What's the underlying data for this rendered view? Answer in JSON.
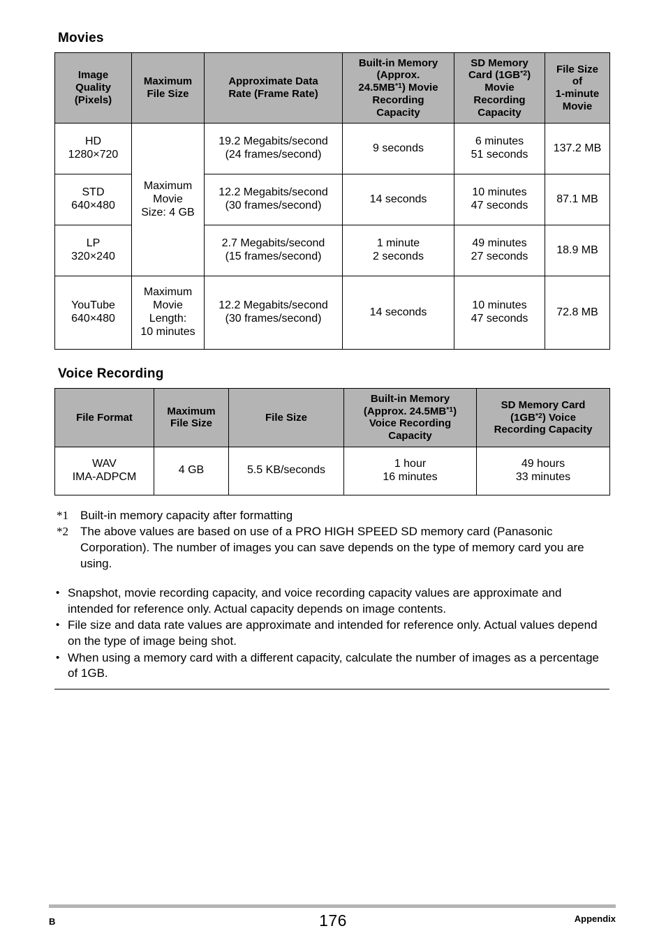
{
  "movies": {
    "heading": "Movies",
    "columns": [
      "Image Quality (Pixels)",
      "Maximum File Size",
      "Approximate Data Rate (Frame Rate)",
      "Built-in Memory (Approx. 24.5MB*1) Movie Recording Capacity",
      "SD Memory Card (1GB*2) Movie Recording Capacity",
      "File Size of 1-minute Movie"
    ],
    "header_lines": {
      "image_quality": [
        "Image",
        "Quality",
        "(Pixels)"
      ],
      "maximum_file_size": [
        "Maximum",
        "File Size"
      ],
      "approx_data_rate": [
        "Approximate Data",
        "Rate (Frame Rate)"
      ],
      "builtin_memory": [
        "Built-in Memory",
        "(Approx.",
        "24.5MB",
        "1",
        ") Movie",
        "Recording",
        "Capacity"
      ],
      "sd_memory": [
        "SD Memory",
        "Card (1GB",
        "2",
        ")",
        "Movie",
        "Recording",
        "Capacity"
      ],
      "file_size_1min": [
        "File Size",
        "of",
        "1-minute",
        "Movie"
      ]
    },
    "rows": [
      {
        "quality_line1": "HD",
        "quality_line2": "1280×720",
        "data_rate_line1": "19.2 Megabits/second",
        "data_rate_line2": "(24 frames/second)",
        "builtin_line1": "9 seconds",
        "builtin_line2": "",
        "sd_line1": "6 minutes",
        "sd_line2": "51 seconds",
        "file_size": "137.2 MB"
      },
      {
        "quality_line1": "STD",
        "quality_line2": "640×480",
        "data_rate_line1": "12.2 Megabits/second",
        "data_rate_line2": "(30 frames/second)",
        "builtin_line1": "14 seconds",
        "builtin_line2": "",
        "sd_line1": "10 minutes",
        "sd_line2": "47 seconds",
        "file_size": "87.1 MB"
      },
      {
        "quality_line1": "LP",
        "quality_line2": "320×240",
        "data_rate_line1": "2.7 Megabits/second",
        "data_rate_line2": "(15 frames/second)",
        "builtin_line1": "1 minute",
        "builtin_line2": "2 seconds",
        "sd_line1": "49 minutes",
        "sd_line2": "27 seconds",
        "file_size": "18.9 MB"
      },
      {
        "quality_line1": "YouTube",
        "quality_line2": "640×480",
        "data_rate_line1": "12.2 Megabits/second",
        "data_rate_line2": "(30 frames/second)",
        "builtin_line1": "14 seconds",
        "builtin_line2": "",
        "sd_line1": "10 minutes",
        "sd_line2": "47 seconds",
        "file_size": "72.8 MB"
      }
    ],
    "max_file_size_group1": [
      "Maximum",
      "Movie",
      "Size: 4 GB"
    ],
    "max_file_size_group2": [
      "Maximum",
      "Movie",
      "Length:",
      "10 minutes"
    ]
  },
  "voice": {
    "heading": "Voice Recording",
    "header_lines": {
      "file_format": [
        "File Format"
      ],
      "maximum_file_size": [
        "Maximum",
        "File Size"
      ],
      "file_size": [
        "File Size"
      ],
      "builtin_memory": [
        "Built-in Memory",
        "(Approx. 24.5MB",
        "1",
        ")",
        "Voice Recording",
        "Capacity"
      ],
      "sd_memory": [
        "SD Memory Card",
        "(1GB",
        "2",
        ") Voice",
        "Recording Capacity"
      ]
    },
    "row": {
      "format_line1": "WAV",
      "format_line2": "IMA-ADPCM",
      "max_file_size": "4 GB",
      "file_size": "5.5 KB/seconds",
      "builtin_line1": "1 hour",
      "builtin_line2": "16 minutes",
      "sd_line1": "49 hours",
      "sd_line2": "33 minutes"
    }
  },
  "footnotes": [
    {
      "marker": "*1",
      "text": "Built-in memory capacity after formatting"
    },
    {
      "marker": "*2",
      "text": "The above values are based on use of a PRO HIGH SPEED SD memory card (Panasonic Corporation). The number of images you can save depends on the type of memory card you are using."
    }
  ],
  "bullets": [
    {
      "dot": "•",
      "text": "Snapshot, movie recording capacity, and voice recording capacity values are approximate and intended for reference only. Actual capacity depends on image contents."
    },
    {
      "dot": "•",
      "text": "File size and data rate values are approximate and intended for reference only. Actual values depend on the type of image being shot."
    },
    {
      "dot": "•",
      "text": "When using a memory card with a different capacity, calculate the number of images as a percentage of 1GB."
    }
  ],
  "footer": {
    "left": "B",
    "page_number": "176",
    "right": "Appendix"
  },
  "colors": {
    "header_fill": "#b4b4b4",
    "border": "#000000",
    "text": "#000000",
    "footer_bar": "#b4b4b4"
  }
}
